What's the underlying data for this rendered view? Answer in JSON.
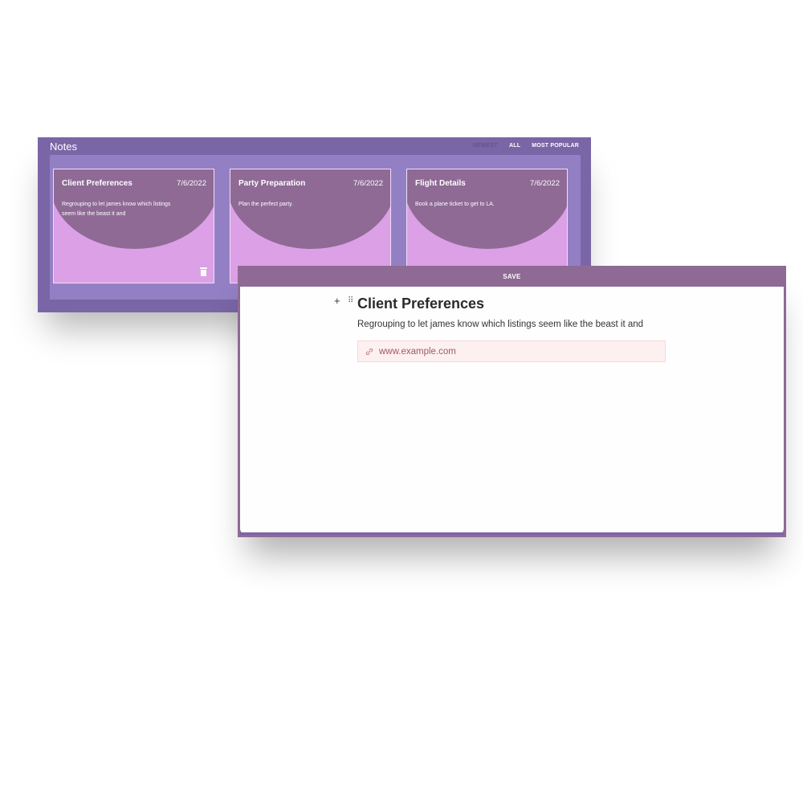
{
  "notes": {
    "title": "Notes",
    "filters": [
      {
        "label": "NEWEST",
        "active": false
      },
      {
        "label": "ALL",
        "active": true
      },
      {
        "label": "MOST POPULAR",
        "active": true
      }
    ],
    "cards": [
      {
        "title": "Client Preferences",
        "date": "7/6/2022",
        "text": "Regrouping to let james know which listings seem like the beast it and",
        "icon": "trash-icon"
      },
      {
        "title": "Party Preparation",
        "date": "7/6/2022",
        "text": "Plan the perfect party."
      },
      {
        "title": "Flight Details",
        "date": "7/6/2022",
        "text": "Book a plane ticket to get to LA."
      }
    ]
  },
  "editor": {
    "save_label": "SAVE",
    "add_symbol": "+",
    "drag_symbol": "⠿",
    "doc_title": "Client Preferences",
    "doc_text": "Regrouping to let james know which listings seem like the beast it and",
    "link_text": "www.example.com",
    "link_icon": "link-icon"
  },
  "colors": {
    "header": "#7a66a6",
    "panel": "#9380c4",
    "card": "#dca0e6",
    "card_blob": "#8e6a95",
    "link_bg": "#fdf0f1",
    "link_text": "#9f5a63"
  }
}
